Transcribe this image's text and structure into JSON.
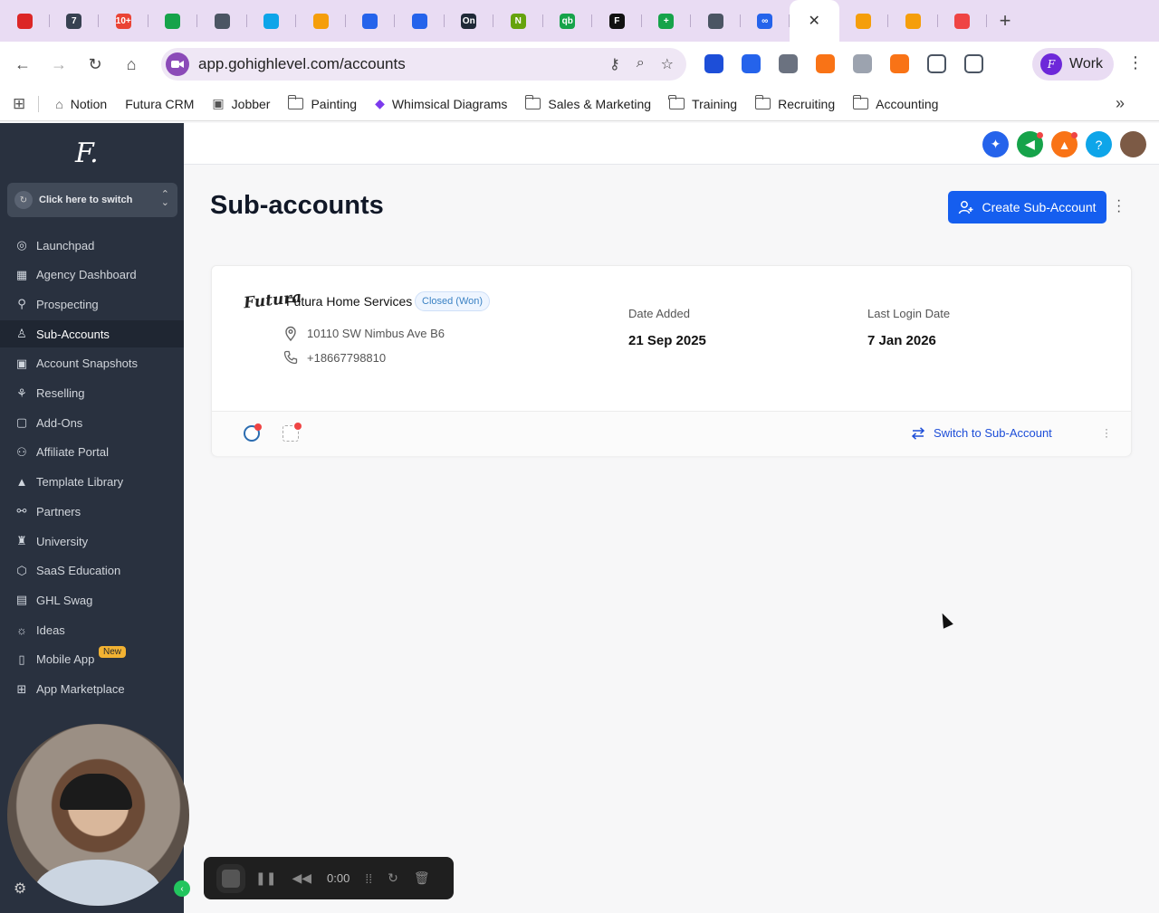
{
  "browser": {
    "tabs": [
      {
        "icon": "record-icon",
        "color": "#dc2626"
      },
      {
        "icon": "calendar-icon",
        "color": "#374151",
        "label": "7"
      },
      {
        "icon": "gmail-icon",
        "color": "#ea4335",
        "label": "10+"
      },
      {
        "icon": "meet-icon",
        "color": "#16a34a"
      },
      {
        "icon": "page-icon",
        "color": "#4b5563"
      },
      {
        "icon": "cloud-icon",
        "color": "#0ea5e9"
      },
      {
        "icon": "palette-icon",
        "color": "#f59e0b"
      },
      {
        "icon": "onepassword-icon",
        "color": "#2563eb"
      },
      {
        "icon": "onepassword-icon",
        "color": "#2563eb"
      },
      {
        "icon": "ontraport-icon",
        "color": "#1f2937",
        "label": "On"
      },
      {
        "icon": "n-icon",
        "color": "#65a30d",
        "label": "N"
      },
      {
        "icon": "quickbooks-icon",
        "color": "#16a34a",
        "label": "qb"
      },
      {
        "icon": "f-icon",
        "color": "#111111",
        "label": "F"
      },
      {
        "icon": "plus-sheet-icon",
        "color": "#16a34a",
        "label": "+"
      },
      {
        "icon": "globe-icon",
        "color": "#4b5563"
      },
      {
        "icon": "meta-icon",
        "color": "#2563eb",
        "label": "∞"
      },
      {
        "icon": "close-icon",
        "active": true
      },
      {
        "icon": "analytics-icon",
        "color": "#f59e0b"
      },
      {
        "icon": "analytics-icon",
        "color": "#f59e0b"
      },
      {
        "icon": "youtube-icon",
        "color": "#ef4444"
      }
    ],
    "url": "app.gohighlevel.com/accounts",
    "profile_name": "Work",
    "profile_initial": "F",
    "bookmarks": [
      {
        "label": "Notion",
        "icon": "home-icon"
      },
      {
        "label": "Futura CRM",
        "icon": "none"
      },
      {
        "label": "Jobber",
        "icon": "jobber-icon"
      },
      {
        "label": "Painting",
        "icon": "folder-icon"
      },
      {
        "label": "Whimsical Diagrams",
        "icon": "whimsical-icon"
      },
      {
        "label": "Sales & Marketing",
        "icon": "folder-icon"
      },
      {
        "label": "Training",
        "icon": "folder-icon"
      },
      {
        "label": "Recruiting",
        "icon": "folder-icon"
      },
      {
        "label": "Accounting",
        "icon": "folder-icon"
      }
    ],
    "bookmarks_more": "»",
    "extensions": [
      "#1d4ed8",
      "#2563eb",
      "#6b7280",
      "#f97316",
      "#9ca3af",
      "#f97316",
      "#4b5563",
      "#4b5563"
    ]
  },
  "sidebar": {
    "logo": "F.",
    "switcher_label": "Click here to switch",
    "items": [
      {
        "label": "Launchpad",
        "icon": "rocket-icon",
        "glyph": "◎"
      },
      {
        "label": "Agency Dashboard",
        "icon": "dashboard-icon",
        "glyph": "▦"
      },
      {
        "label": "Prospecting",
        "icon": "prospecting-icon",
        "glyph": "⚲"
      },
      {
        "label": "Sub-Accounts",
        "icon": "user-icon",
        "glyph": "♙",
        "active": true
      },
      {
        "label": "Account Snapshots",
        "icon": "snapshot-icon",
        "glyph": "▣"
      },
      {
        "label": "Reselling",
        "icon": "reselling-icon",
        "glyph": "⚘"
      },
      {
        "label": "Add-Ons",
        "icon": "bag-icon",
        "glyph": "▢"
      },
      {
        "label": "Affiliate Portal",
        "icon": "affiliate-icon",
        "glyph": "⚇"
      },
      {
        "label": "Template Library",
        "icon": "template-icon",
        "glyph": "▲"
      },
      {
        "label": "Partners",
        "icon": "handshake-icon",
        "glyph": "⚯"
      },
      {
        "label": "University",
        "icon": "graduation-icon",
        "glyph": "♜"
      },
      {
        "label": "SaaS Education",
        "icon": "cube-icon",
        "glyph": "⬡"
      },
      {
        "label": "GHL Swag",
        "icon": "store-icon",
        "glyph": "▤"
      },
      {
        "label": "Ideas",
        "icon": "lightbulb-icon",
        "glyph": "☼"
      },
      {
        "label": "Mobile App",
        "icon": "phone-icon",
        "glyph": "▯"
      },
      {
        "label": "App Marketplace",
        "icon": "grid-icon",
        "glyph": "⊞"
      }
    ],
    "new_badge": "New"
  },
  "header": {
    "buttons": [
      {
        "icon": "ai-sparkle-icon",
        "color": "#2563eb",
        "glyph": "✦"
      },
      {
        "icon": "megaphone-icon",
        "color": "#16a34a",
        "glyph": "◀",
        "dot": true
      },
      {
        "icon": "bell-icon",
        "color": "#f97316",
        "glyph": "▲",
        "dot": true
      },
      {
        "icon": "help-icon",
        "color": "#0ea5e9",
        "glyph": "?"
      },
      {
        "icon": "avatar",
        "color": "#7c5a45",
        "glyph": ""
      }
    ]
  },
  "main": {
    "title": "Sub-accounts",
    "create_button": "Create Sub-Account",
    "card": {
      "logo_text": "Futura",
      "name": "Futura Home Services",
      "status": "Closed (Won)",
      "address": "10110 SW Nimbus Ave B6",
      "phone": "+18667798810",
      "date_added_label": "Date Added",
      "date_added": "21 Sep 2025",
      "last_login_label": "Last Login Date",
      "last_login": "7 Jan 2026",
      "switch_label": "Switch to Sub-Account"
    }
  },
  "recorder": {
    "time": "0:00"
  }
}
